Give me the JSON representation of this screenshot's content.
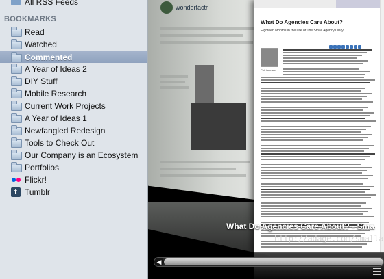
{
  "sidebar": {
    "top_item": "All RSS Feeds",
    "header": "BOOKMARKS",
    "items": [
      {
        "label": "Read",
        "icon": "folder-icon"
      },
      {
        "label": "Watched",
        "icon": "folder-icon"
      },
      {
        "label": "Commented",
        "icon": "folder-icon",
        "selected": true
      },
      {
        "label": "A Year of Ideas 2",
        "icon": "folder-icon"
      },
      {
        "label": "DIY Stuff",
        "icon": "folder-icon"
      },
      {
        "label": "Mobile Research",
        "icon": "folder-icon"
      },
      {
        "label": "Current Work Projects",
        "icon": "folder-icon"
      },
      {
        "label": "A Year of Ideas 1",
        "icon": "folder-icon"
      },
      {
        "label": "Newfangled Redesign",
        "icon": "folder-icon"
      },
      {
        "label": "Tools to Check Out",
        "icon": "folder-icon"
      },
      {
        "label": "Our Company is an Ecosystem",
        "icon": "folder-icon"
      },
      {
        "label": "Portfolios",
        "icon": "folder-icon"
      },
      {
        "label": "Flickr!",
        "icon": "flickr-icon"
      },
      {
        "label": "Tumblr",
        "icon": "tumblr-icon"
      }
    ]
  },
  "coverflow": {
    "back_page_logo": "wonderfactr",
    "front_page": {
      "headline": "What Do Agencies Care About?",
      "subtitle": "Eighteen Months in the Life of The Small Agency Diary",
      "photo_caption": "Phil Johnson"
    },
    "selected_title": "What Do Agencies Care About? - Sma",
    "selected_url": "http://adage.com/smallagenc"
  },
  "colors": {
    "sidebar_bg": "#dfe4ea",
    "selected_row": "#8fa2be",
    "flickr_blue": "#0063dc",
    "flickr_pink": "#ff0084",
    "tumblr_navy": "#2c4762"
  }
}
